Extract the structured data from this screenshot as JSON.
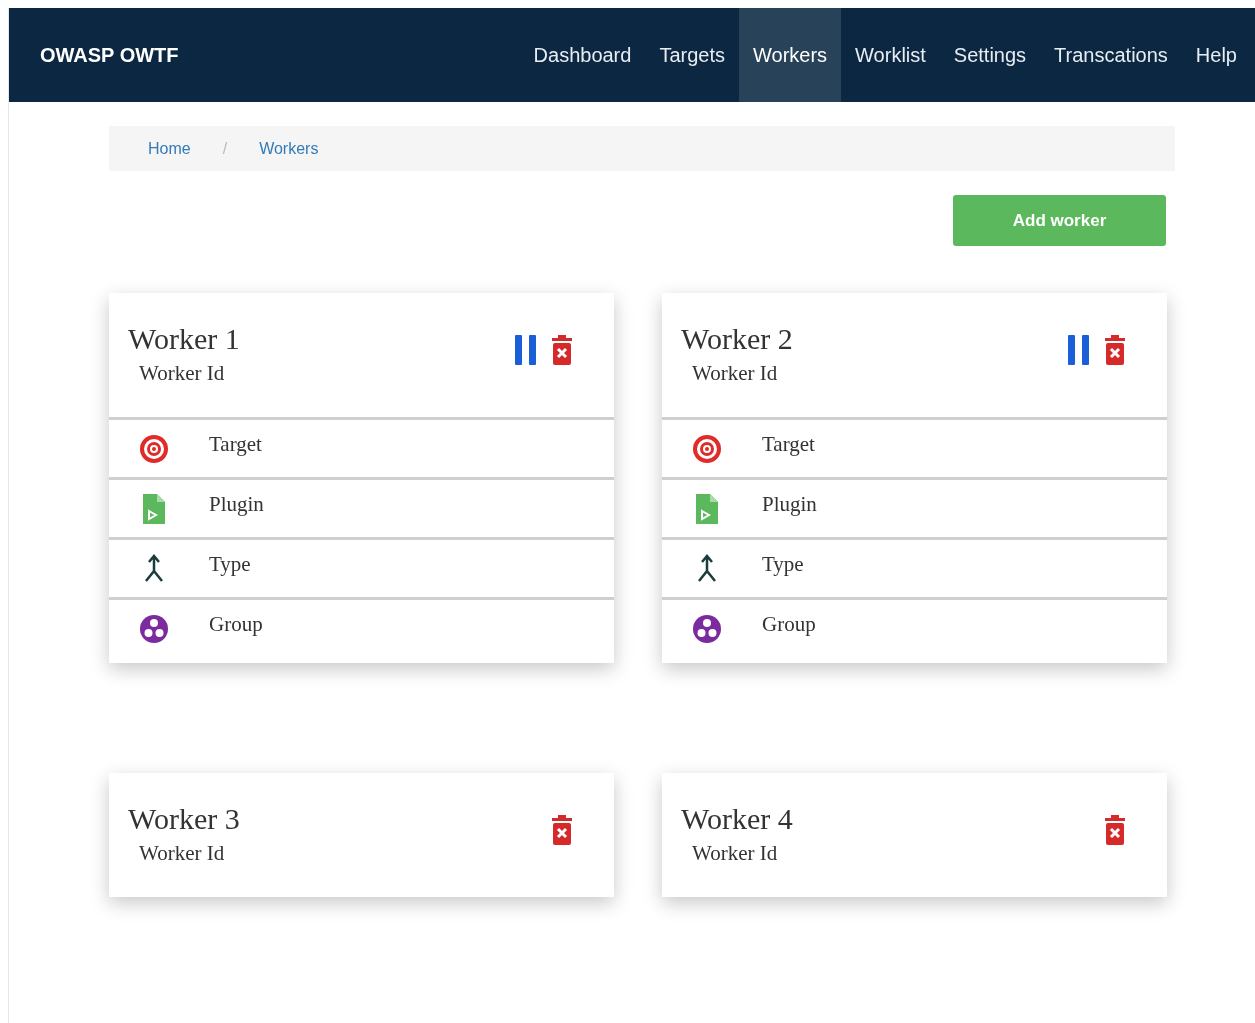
{
  "navbar": {
    "brand": "OWASP OWTF",
    "links": [
      {
        "label": "Dashboard",
        "selected": false
      },
      {
        "label": "Targets",
        "selected": false
      },
      {
        "label": "Workers",
        "selected": true
      },
      {
        "label": "Worklist",
        "selected": false
      },
      {
        "label": "Settings",
        "selected": false
      },
      {
        "label": "Transcations",
        "selected": false
      },
      {
        "label": "Help",
        "selected": false
      }
    ]
  },
  "breadcrumb": [
    "Home",
    "Workers"
  ],
  "breadcrumb_separator": "/",
  "add_button": "Add worker",
  "workers": [
    {
      "name": "Worker 1",
      "subtitle": "Worker Id",
      "pausable": true,
      "details": [
        {
          "kind": "target",
          "label": "Target"
        },
        {
          "kind": "plugin",
          "label": "Plugin"
        },
        {
          "kind": "type",
          "label": "Type"
        },
        {
          "kind": "group",
          "label": "Group"
        }
      ]
    },
    {
      "name": "Worker 2",
      "subtitle": "Worker Id",
      "pausable": true,
      "details": [
        {
          "kind": "target",
          "label": "Target"
        },
        {
          "kind": "plugin",
          "label": "Plugin"
        },
        {
          "kind": "type",
          "label": "Type"
        },
        {
          "kind": "group",
          "label": "Group"
        }
      ]
    },
    {
      "name": "Worker 3",
      "subtitle": "Worker Id",
      "pausable": false
    },
    {
      "name": "Worker 4",
      "subtitle": "Worker Id",
      "pausable": false
    }
  ]
}
